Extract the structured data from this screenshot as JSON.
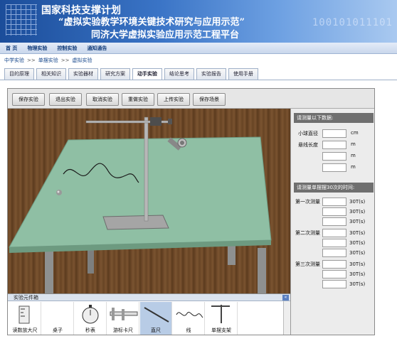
{
  "banner": {
    "line1": "国家科技支撑计划",
    "line2": "“虚拟实验教学环境关键技术研究与应用示范”",
    "line3": "同济大学虚拟实验应用示范工程平台",
    "binary": "100101011101"
  },
  "nav": [
    "首 页",
    "物理实验",
    "控制实验",
    "通知通告"
  ],
  "breadcrumb": [
    "中学实验",
    "单摆实验",
    "虚拟实验"
  ],
  "breadcrumb_sep": ">>",
  "tabs": [
    {
      "label": "目的原理",
      "active": false
    },
    {
      "label": "相关知识",
      "active": false
    },
    {
      "label": "实验器材",
      "active": false
    },
    {
      "label": "研究方案",
      "active": false
    },
    {
      "label": "动手实验",
      "active": true
    },
    {
      "label": "结论思考",
      "active": false
    },
    {
      "label": "实验报告",
      "active": false
    },
    {
      "label": "使用手册",
      "active": false
    }
  ],
  "toolbar": [
    "保存实验",
    "退出实验",
    "取消实验",
    "重做实验",
    "上传实验",
    "保存场景"
  ],
  "panel": {
    "section1_title": "请测量以下数据:",
    "ball_diameter_label": "小球直径",
    "ball_diameter_unit": "cm",
    "line_length_label": "悬线长度",
    "length_unit": "m",
    "section2_title": "请测量单摆摆30次的时间:",
    "measurements": [
      "第一次测量",
      "第二次测量",
      "第三次测量"
    ],
    "time_unit": "30T(s)"
  },
  "bin": {
    "title": "实验元件箱",
    "collapse_glyph": "«",
    "items": [
      {
        "label": "读数放大尺",
        "selected": false
      },
      {
        "label": "桌子",
        "selected": false
      },
      {
        "label": "秒表",
        "selected": false
      },
      {
        "label": "游标卡尺",
        "selected": false
      },
      {
        "label": "直尺",
        "selected": true
      },
      {
        "label": "线",
        "selected": false
      },
      {
        "label": "单摆支架",
        "selected": false
      }
    ]
  }
}
